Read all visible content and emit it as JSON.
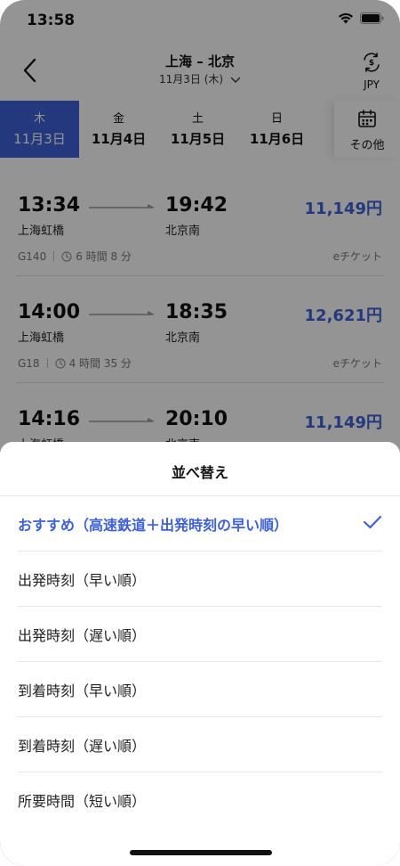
{
  "status": {
    "time": "13:58"
  },
  "nav": {
    "route": "上海 – 北京",
    "date": "11月3日 (木)",
    "currency": "JPY"
  },
  "tabs": [
    {
      "dow": "木",
      "date": "11月3日",
      "active": true
    },
    {
      "dow": "金",
      "date": "11月4日"
    },
    {
      "dow": "土",
      "date": "11月5日"
    },
    {
      "dow": "日",
      "date": "11月6日"
    }
  ],
  "more_label": "その他",
  "trains": [
    {
      "dep_time": "13:34",
      "dep_station": "上海虹橋",
      "arr_time": "19:42",
      "arr_station": "北京南",
      "price": "11,149円",
      "number": "G140",
      "duration": "6 時間 8 分",
      "ticket": "eチケット"
    },
    {
      "dep_time": "14:00",
      "dep_station": "上海虹橋",
      "arr_time": "18:35",
      "arr_station": "北京南",
      "price": "12,621円",
      "number": "G18",
      "duration": "4 時間 35 分",
      "ticket": "eチケット"
    },
    {
      "dep_time": "14:16",
      "dep_station": "上海虹橋",
      "arr_time": "20:10",
      "arr_station": "北京南",
      "price": "11,149円",
      "number": "",
      "duration": "",
      "ticket": ""
    }
  ],
  "sort_sheet": {
    "title": "並べ替え",
    "options": [
      {
        "label": "おすすめ（高速鉄道＋出発時刻の早い順）",
        "selected": true
      },
      {
        "label": "出発時刻（早い順）"
      },
      {
        "label": "出発時刻（遅い順）"
      },
      {
        "label": "到着時刻（早い順）"
      },
      {
        "label": "到着時刻（遅い順）"
      },
      {
        "label": "所要時間（短い順）"
      }
    ]
  },
  "colors": {
    "accent": "#3e61d8"
  },
  "icons": [
    "back-icon",
    "wifi-icon",
    "battery-icon",
    "currency-exchange-icon",
    "calendar-icon",
    "clock-icon",
    "arrow-icon",
    "check-icon"
  ]
}
